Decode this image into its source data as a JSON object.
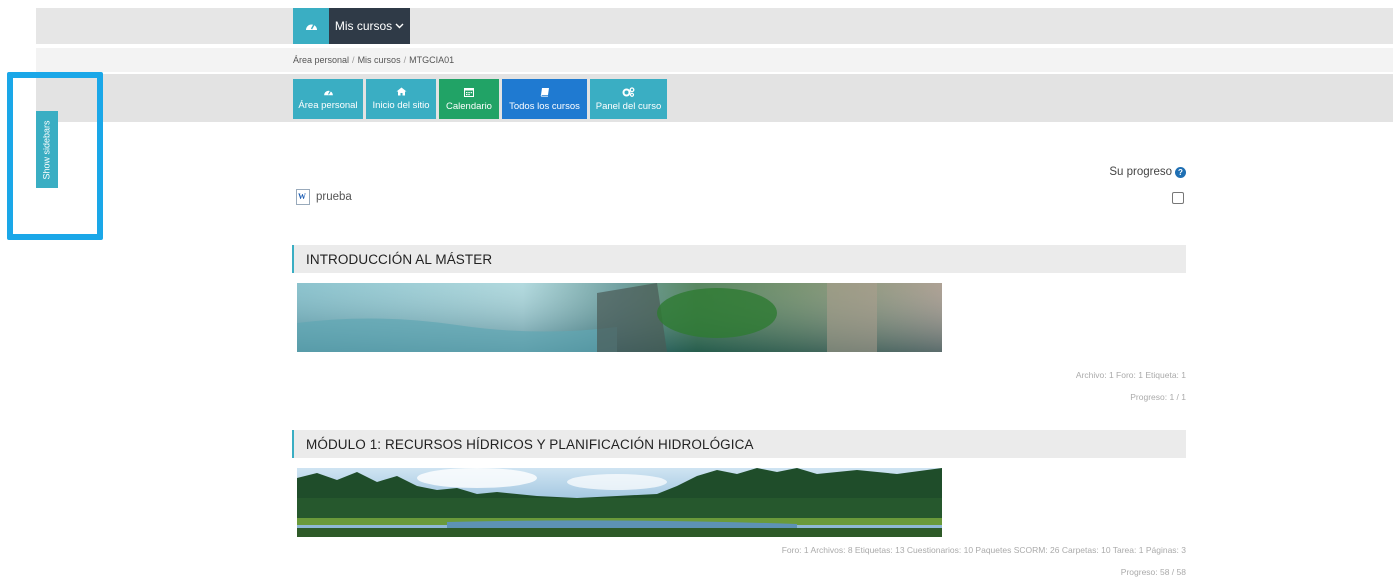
{
  "topbar": {
    "dashboard_icon": "dashboard-icon",
    "courses_label": "Mis cursos",
    "courses_caret": "chevron-down-icon"
  },
  "breadcrumb": {
    "items": [
      "Área personal",
      "Mis cursos",
      "MTGCIA01"
    ],
    "separator": "/"
  },
  "nav": {
    "buttons": [
      {
        "label": "Área personal",
        "icon": "dashboard-icon",
        "color": "#3aaec3"
      },
      {
        "label": "Inicio del sitio",
        "icon": "home-icon",
        "color": "#3aaec3"
      },
      {
        "label": "Calendario",
        "icon": "calendar-icon",
        "color": "#21a366"
      },
      {
        "label": "Todos los cursos",
        "icon": "book-icon",
        "color": "#1f7ad1"
      },
      {
        "label": "Panel del curso",
        "icon": "cogs-icon",
        "color": "#3aaec3"
      }
    ]
  },
  "sidebar": {
    "toggle_label": "Show sidebars"
  },
  "progress": {
    "label": "Su progreso"
  },
  "top_item": {
    "name": "prueba",
    "icon": "word-document-icon"
  },
  "sections": [
    {
      "title": "INTRODUCCIÓN AL MÁSTER",
      "summary": "Archivo: 1  Foro: 1  Etiqueta: 1",
      "progress": "Progreso: 1 / 1"
    },
    {
      "title": "MÓDULO 1: RECURSOS HÍDRICOS Y PLANIFICACIÓN HIDROLÓGICA",
      "summary": "Foro: 1  Archivos: 8  Etiquetas: 13  Cuestionarios: 10  Paquetes SCORM: 26  Carpetas: 10  Tarea: 1  Páginas: 3",
      "progress": "Progreso: 58 / 58"
    }
  ],
  "colors": {
    "accent": "#3aaec3",
    "dark": "#2f3a47",
    "highlight": "#1aa7e8"
  }
}
